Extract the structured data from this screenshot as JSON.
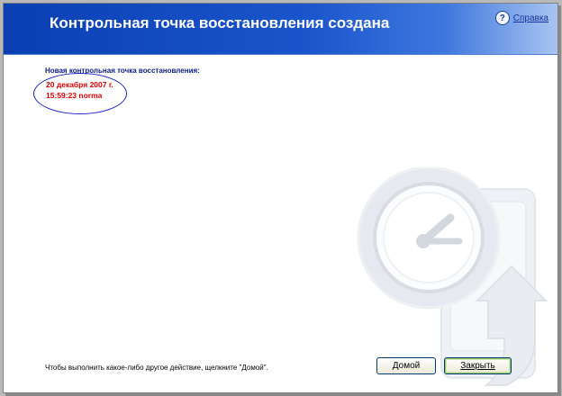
{
  "header": {
    "title": "Контрольная точка восстановления создана",
    "help_label": "Справка",
    "help_icon": "question-icon"
  },
  "restore_point": {
    "heading": "Новая контрольная точка восстановления:",
    "date": "20 декабря 2007 г.",
    "time_name": "15:59:23  norma"
  },
  "footer": {
    "instruction": "Чтобы выполнить какое-либо другое действие, щелкните \"Домой\".",
    "home_button": "Домой",
    "close_button": "Закрыть"
  },
  "colors": {
    "header_blue": "#1a55cc",
    "heading_navy": "#0a1c8a",
    "highlight_red": "#d80000",
    "oval_blue": "#1c24c8"
  },
  "watermark_icon": "clock-restore-arrow-icon"
}
